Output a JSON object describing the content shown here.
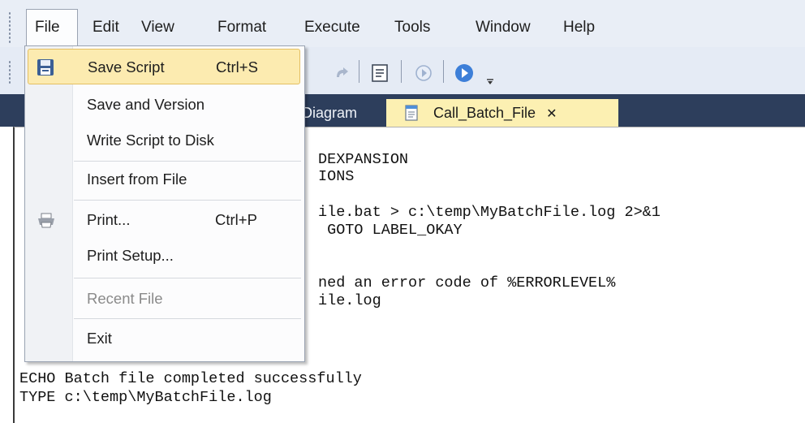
{
  "menubar": {
    "items": [
      "File",
      "Edit",
      "View",
      "Format",
      "Execute",
      "Tools",
      "Window",
      "Help"
    ]
  },
  "tabs": {
    "diagram": "Diagram",
    "call_batch": "Call_Batch_File",
    "close_glyph": "✕"
  },
  "file_menu": {
    "items": [
      {
        "label": "Save Script",
        "shortcut": "Ctrl+S",
        "icon": "save-icon",
        "highlighted": true,
        "enabled": true
      },
      {
        "label": "Save and Version",
        "shortcut": "",
        "enabled": true
      },
      {
        "label": "Write Script to Disk",
        "shortcut": "",
        "enabled": true
      },
      {
        "label": "Insert from File",
        "shortcut": "",
        "enabled": true
      },
      {
        "label": "Print...",
        "shortcut": "Ctrl+P",
        "icon": "printer-icon",
        "enabled": true
      },
      {
        "label": "Print Setup...",
        "shortcut": "",
        "enabled": true
      },
      {
        "label": "Recent File",
        "shortcut": "",
        "enabled": false
      },
      {
        "label": "Exit",
        "shortcut": "",
        "enabled": true
      }
    ]
  },
  "editor": {
    "lines": [
      "DEXPANSION",
      "IONS",
      "ile.bat > c:\\temp\\MyBatchFile.log 2>&1",
      " GOTO LABEL_OKAY",
      "ned an error code of %ERRORLEVEL%",
      "ile.log",
      "ECHO Batch file completed successfully",
      "TYPE c:\\temp\\MyBatchFile.log"
    ]
  },
  "colors": {
    "menu_highlight": "#fcebb0",
    "tabstrip": "#2d3e5c",
    "active_tab": "#fcf0b2",
    "disabled_text": "#8a8a8a"
  }
}
